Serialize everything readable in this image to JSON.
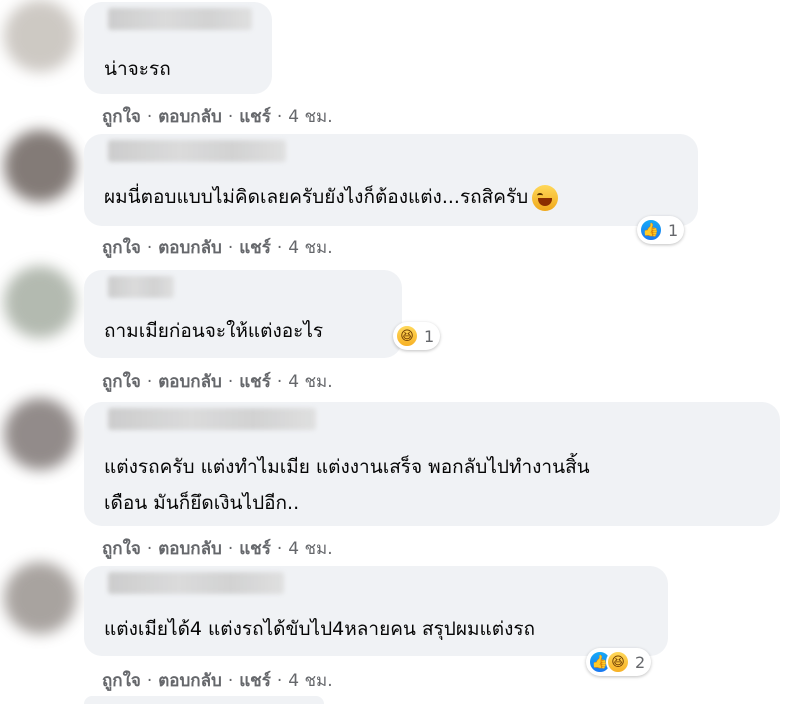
{
  "comments": [
    {
      "text": "น่าจะรถ",
      "actions": {
        "like": "ถูกใจ",
        "reply": "ตอบกลับ",
        "share": "แชร์",
        "time": "4 ชม."
      }
    },
    {
      "text": "ผมนี่ตอบแบบไม่คิดเลยครับยังไงก็ต้องแต่ง...รถสิครับ",
      "inline_emoji": "laughing-tears-emoji",
      "reactions": {
        "icons": [
          "like"
        ],
        "count": "1"
      },
      "actions": {
        "like": "ถูกใจ",
        "reply": "ตอบกลับ",
        "share": "แชร์",
        "time": "4 ชม."
      }
    },
    {
      "text": "ถามเมียก่อนจะให้แต่งอะไร",
      "reactions": {
        "icons": [
          "haha"
        ],
        "count": "1"
      },
      "actions": {
        "like": "ถูกใจ",
        "reply": "ตอบกลับ",
        "share": "แชร์",
        "time": "4 ชม."
      }
    },
    {
      "text_line1": "แต่งรถครับ แต่งทำไมเมีย แต่งงานเสร็จ พอกลับไปทำงานสิ้น",
      "text_line2": "เดือน มันก็ยึดเงินไปอีก..",
      "actions": {
        "like": "ถูกใจ",
        "reply": "ตอบกลับ",
        "share": "แชร์",
        "time": "4 ชม."
      }
    },
    {
      "text": "แต่งเมียได้4 แต่งรถได้ขับไป4หลายคน สรุปผมแต่งรถ",
      "reactions": {
        "icons": [
          "like",
          "haha"
        ],
        "count": "2"
      },
      "actions": {
        "like": "ถูกใจ",
        "reply": "ตอบกลับ",
        "share": "แชร์",
        "time": "4 ชม."
      }
    }
  ],
  "colors": {
    "bubble": "#f0f2f5",
    "meta_text": "#65676b",
    "like_blue": "#1877f2",
    "haha_yellow": "#f7b125"
  },
  "dot": "·"
}
